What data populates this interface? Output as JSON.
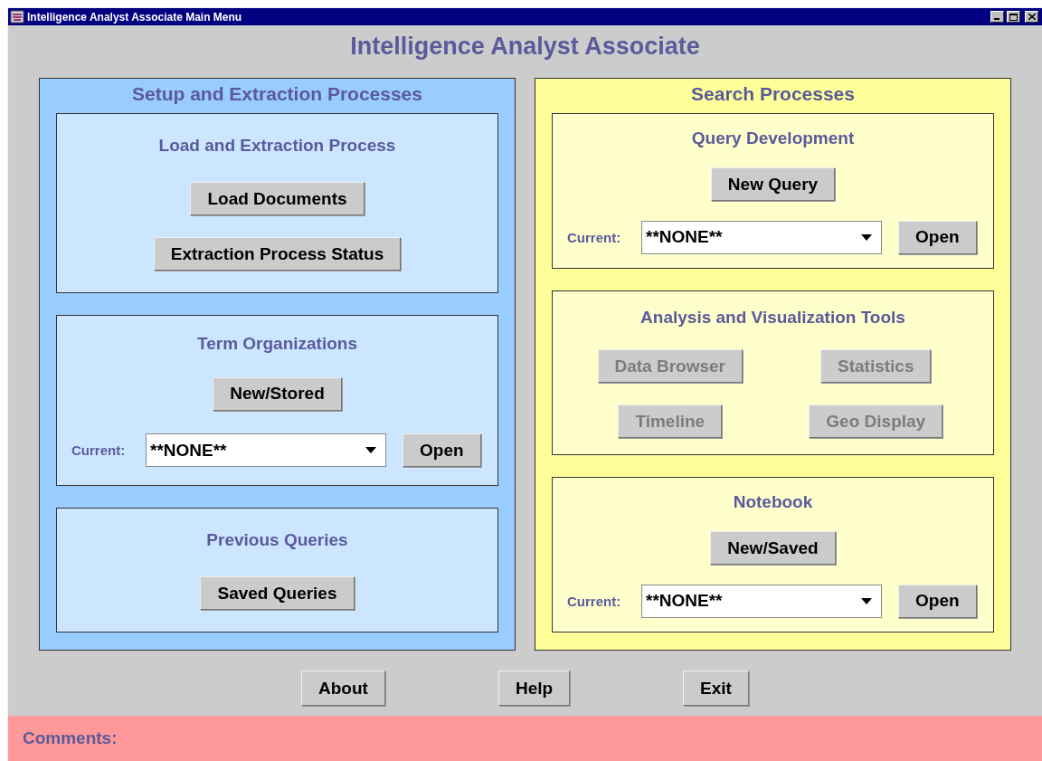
{
  "window": {
    "title": "Intelligence Analyst Associate Main Menu"
  },
  "heading": "Intelligence Analyst Associate",
  "sections": [
    {
      "title": "Setup and Extraction Processes",
      "color": "#99ccff",
      "panels": [
        {
          "title": "Load and Extraction Process",
          "kind": "stack",
          "buttons": [
            {
              "label": "Load Documents",
              "disabled": false
            },
            {
              "label": "Extraction Process Status",
              "disabled": false
            }
          ]
        },
        {
          "title": "Term Organizations",
          "kind": "stack",
          "buttons": [
            {
              "label": "New/Stored",
              "disabled": false
            }
          ],
          "current": {
            "label": "Current:",
            "value": "**NONE**",
            "button": "Open"
          }
        },
        {
          "title": "Previous Queries",
          "kind": "stack",
          "buttons": [
            {
              "label": "Saved Queries",
              "disabled": false
            }
          ]
        }
      ]
    },
    {
      "title": "Search Processes",
      "color": "#ffff99",
      "panels": [
        {
          "title": "Query Development",
          "kind": "stack",
          "buttons": [
            {
              "label": "New Query",
              "disabled": false
            }
          ],
          "current": {
            "label": "Current:",
            "value": "**NONE**",
            "button": "Open"
          }
        },
        {
          "title": "Analysis and Visualization Tools",
          "kind": "grid",
          "buttons": [
            {
              "label": "Data Browser",
              "disabled": true
            },
            {
              "label": "Statistics",
              "disabled": true
            },
            {
              "label": "Timeline",
              "disabled": true
            },
            {
              "label": "Geo Display",
              "disabled": true
            }
          ]
        },
        {
          "title": "Notebook",
          "kind": "stack",
          "buttons": [
            {
              "label": "New/Saved",
              "disabled": false
            }
          ],
          "current": {
            "label": "Current:",
            "value": "**NONE**",
            "button": "Open"
          }
        }
      ]
    }
  ],
  "footer_buttons": [
    "About",
    "Help",
    "Exit"
  ],
  "comments": {
    "label": "Comments:"
  }
}
